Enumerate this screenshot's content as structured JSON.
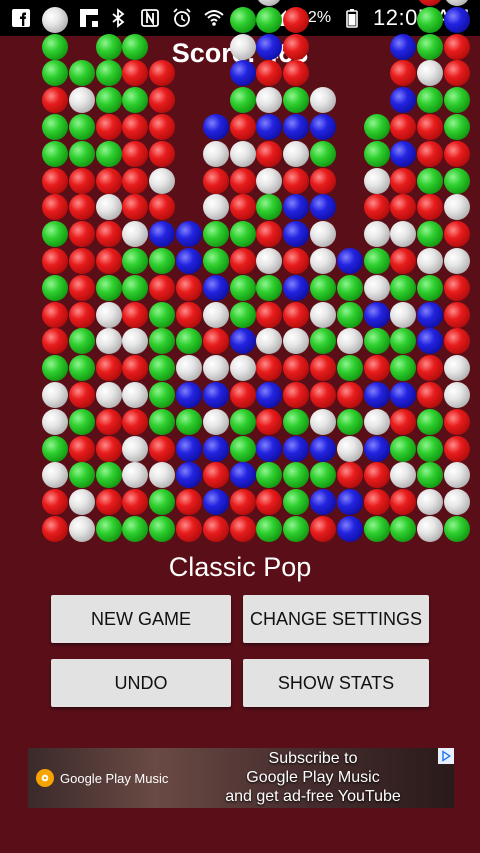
{
  "status_bar": {
    "icons_left": [
      "facebook-icon",
      "sim-card-icon",
      "flipboard-icon"
    ],
    "icons_right": [
      "bluetooth-icon",
      "nfc-icon",
      "alarm-icon",
      "wifi-icon",
      "no-signal-icon",
      "cell-signal-icon",
      "battery-icon"
    ],
    "battery": "82%",
    "time": "12:05 AM"
  },
  "score": {
    "text": "Score: 463"
  },
  "board": {
    "colors": {
      "W": "white",
      "G": "green",
      "R": "red",
      "B": "blue"
    },
    "columns": [
      "RRWGWWGRRGRGRRGGRGGW",
      "WWGRGRGGRRRRRRGGWG",
      "GRGRRWRWWGRRWRGRGGG",
      "GRWWRWRWRGGWRRRRGRG",
      "GGWRGGGGGRGBRWRRRR",
      "RRBBGBWGRRBB",
      "RBRBWBWRWBGGWRWB",
      "RRBGGRWBGGRGRRWRGBWG",
      "GRGBRBRWRGWRGWRBWRBGW",
      "GGGBGRRWRBRBBRWBGRRR",
      "RBGBWRRGWGWWBRGBW",
      "BBRWGRGWGGB",
      "GRRBWBRGBWGWRWGG",
      "GRWGRBGGWGRWRRBRBRB",
      "WWGGGRRBBGWGRGRRGWGGRB",
      "GWWRRWWRRRWRWGRGGRRBW"
    ]
  },
  "mode_label": "Classic Pop",
  "buttons": {
    "new_game": "NEW GAME",
    "change_settings": "CHANGE SETTINGS",
    "undo": "UNDO",
    "show_stats": "SHOW STATS"
  },
  "ad": {
    "brand": "Google Play Music",
    "line1": "Subscribe to",
    "line2": "Google Play Music",
    "line3": "and get ad-free YouTube"
  }
}
